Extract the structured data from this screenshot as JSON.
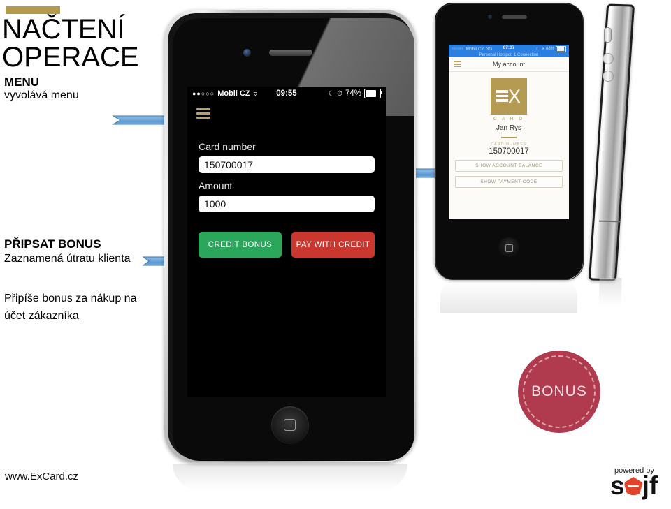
{
  "slide": {
    "title_line1": "NAČTENÍ",
    "title_line2": "OPERACE",
    "section1_head": "MENU",
    "section1_text": "vyvolává menu",
    "section2_head": "PŘIPSAT BONUS",
    "section2_text": "Zaznamená útratu klienta",
    "section3_text": "Připíše bonus za nákup na účet zákazníka",
    "footer_url": "www.ExCard.cz",
    "gold_accent": "#b39a4d",
    "arrow_color": "#5b9bd5"
  },
  "phone_main": {
    "status_bar": {
      "signal_dots": "●●○○○",
      "carrier": "Mobil CZ",
      "wifi_icon": "wifi-icon",
      "time": "09:55",
      "moon_icon": "moon-icon",
      "alarm_icon": "alarm-icon",
      "battery_percent": "74%"
    },
    "nav": {
      "menu_icon": "hamburger-menu-icon"
    },
    "form": {
      "card_number_label": "Card number",
      "card_number_value": "150700017",
      "amount_label": "Amount",
      "amount_value": "1000"
    },
    "buttons": {
      "credit_bonus": "CREDIT BONUS",
      "credit_bonus_color": "#2aa75a",
      "pay_with_credit": "PAY WITH CREDIT",
      "pay_with_credit_color": "#c9372e"
    },
    "home_button": "home-button"
  },
  "phone_account": {
    "status_bar": {
      "signal_dots": "○○○○○",
      "carrier": "Mobil CZ",
      "network": "3G",
      "time": "07:37",
      "battery_percent": "88%",
      "hotspot_text": "Personal Hotspot: 1 Connection"
    },
    "nav": {
      "menu_icon": "hamburger-menu-icon",
      "title": "My account"
    },
    "card": {
      "logo_letters": "X",
      "logo_word": "C A R D",
      "holder_name": "Jan Rys",
      "card_number_label": "CARD NUMBER",
      "card_number_value": "150700017"
    },
    "buttons": {
      "show_balance": "SHOW ACCOUNT BALANCE",
      "show_payment_code": "SHOW PAYMENT CODE"
    },
    "home_button": "home-button"
  },
  "phone_side": {
    "label": "iphone-side-profile"
  },
  "bonus_stamp": {
    "label": "BONUS",
    "color": "#b03a4e"
  },
  "powered_by": {
    "text": "powered by",
    "brand_s": "s",
    "brand_jf": "jf"
  }
}
